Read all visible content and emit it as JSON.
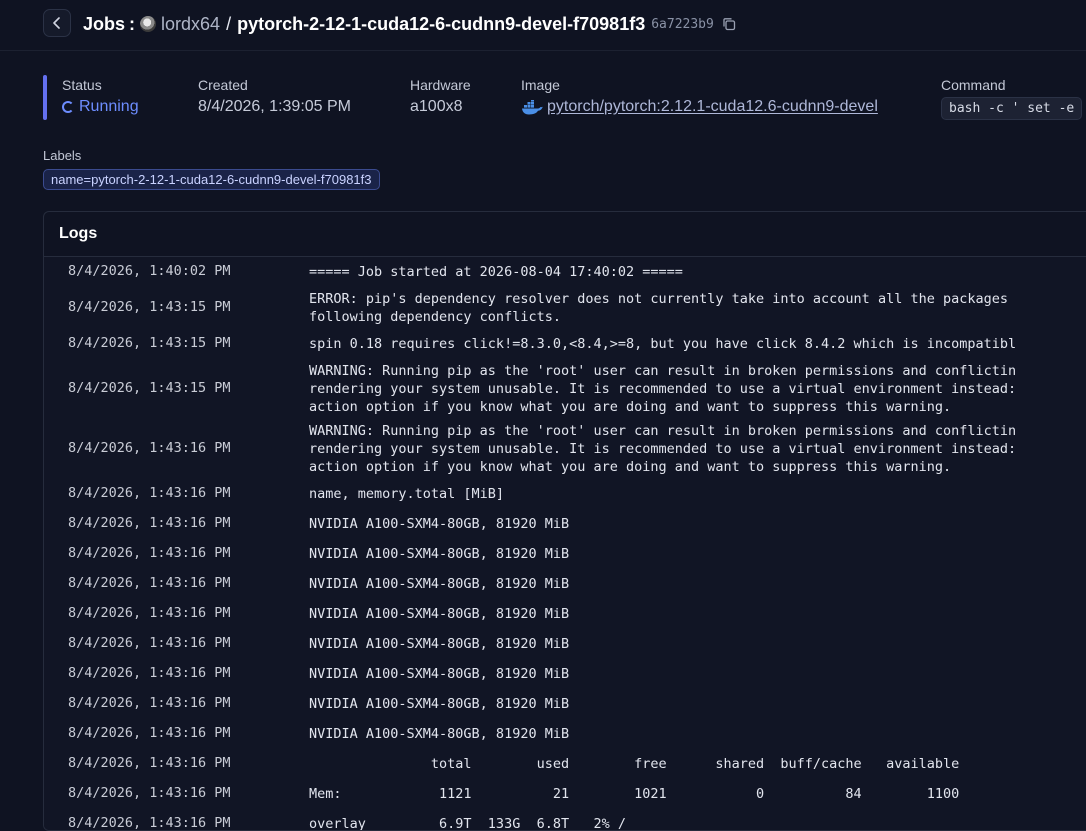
{
  "header": {
    "jobs_label": "Jobs",
    "separator": ":",
    "user": "lordx64",
    "slash": "/",
    "job_name": "pytorch-2-12-1-cuda12-6-cudnn9-devel-f70981f3",
    "job_id": "6a7223b9"
  },
  "meta": {
    "status_label": "Status",
    "status_value": "Running",
    "created_label": "Created",
    "created_value": "8/4/2026, 1:39:05 PM",
    "hardware_label": "Hardware",
    "hardware_value": "a100x8",
    "image_label": "Image",
    "image_owner": "pytorch",
    "image_sep": "/",
    "image_name": "pytorch:2.12.1-cuda12.6-cudnn9-devel",
    "command_label": "Command",
    "command_value": "bash -c ' set -e"
  },
  "labels": {
    "title": "Labels",
    "items": [
      "name=pytorch-2-12-1-cuda12-6-cudnn9-devel-f70981f3"
    ]
  },
  "logs": {
    "title": "Logs",
    "rows": [
      {
        "ts": "8/4/2026, 1:40:02 PM",
        "msg": "===== Job started at 2026-08-04 17:40:02 ====="
      },
      {
        "ts": "8/4/2026, 1:43:15 PM",
        "msg": "ERROR: pip's dependency resolver does not currently take into account all the packages\nfollowing dependency conflicts."
      },
      {
        "ts": "8/4/2026, 1:43:15 PM",
        "msg": "spin 0.18 requires click!=8.3.0,<8.4,>=8, but you have click 8.4.2 which is incompatibl"
      },
      {
        "ts": "8/4/2026, 1:43:15 PM",
        "msg": "WARNING: Running pip as the 'root' user can result in broken permissions and conflictin\nrendering your system unusable. It is recommended to use a virtual environment instead:\naction option if you know what you are doing and want to suppress this warning."
      },
      {
        "ts": "8/4/2026, 1:43:16 PM",
        "msg": "WARNING: Running pip as the 'root' user can result in broken permissions and conflictin\nrendering your system unusable. It is recommended to use a virtual environment instead:\naction option if you know what you are doing and want to suppress this warning."
      },
      {
        "ts": "8/4/2026, 1:43:16 PM",
        "msg": "name, memory.total [MiB]"
      },
      {
        "ts": "8/4/2026, 1:43:16 PM",
        "msg": "NVIDIA A100-SXM4-80GB, 81920 MiB"
      },
      {
        "ts": "8/4/2026, 1:43:16 PM",
        "msg": "NVIDIA A100-SXM4-80GB, 81920 MiB"
      },
      {
        "ts": "8/4/2026, 1:43:16 PM",
        "msg": "NVIDIA A100-SXM4-80GB, 81920 MiB"
      },
      {
        "ts": "8/4/2026, 1:43:16 PM",
        "msg": "NVIDIA A100-SXM4-80GB, 81920 MiB"
      },
      {
        "ts": "8/4/2026, 1:43:16 PM",
        "msg": "NVIDIA A100-SXM4-80GB, 81920 MiB"
      },
      {
        "ts": "8/4/2026, 1:43:16 PM",
        "msg": "NVIDIA A100-SXM4-80GB, 81920 MiB"
      },
      {
        "ts": "8/4/2026, 1:43:16 PM",
        "msg": "NVIDIA A100-SXM4-80GB, 81920 MiB"
      },
      {
        "ts": "8/4/2026, 1:43:16 PM",
        "msg": "NVIDIA A100-SXM4-80GB, 81920 MiB"
      },
      {
        "ts": "8/4/2026, 1:43:16 PM",
        "msg": "               total        used        free      shared  buff/cache   available"
      },
      {
        "ts": "8/4/2026, 1:43:16 PM",
        "msg": "Mem:            1121          21        1021           0          84        1100"
      },
      {
        "ts": "8/4/2026, 1:43:16 PM",
        "msg": "overlay         6.9T  133G  6.8T   2% /"
      }
    ]
  },
  "colors": {
    "accent": "#6470f0",
    "running": "#6d8dff",
    "background": "#0f1322"
  }
}
